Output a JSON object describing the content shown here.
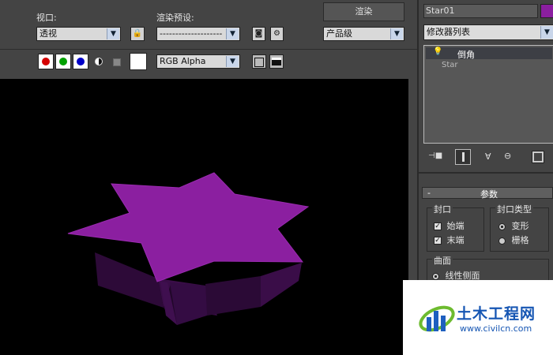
{
  "toolbar": {
    "viewport_label": "视口:",
    "viewport_value": "透视",
    "preset_label": "渲染预设:",
    "preset_value": "--------------------",
    "render_button": "渲染",
    "quality_value": "产品级",
    "channel_value": "RGB Alpha",
    "colors": {
      "red": "#d40000",
      "green": "#00a000",
      "blue": "#0000c8"
    }
  },
  "viewport": {
    "background": "#000000",
    "object_color": "#8b1fa0"
  },
  "panel": {
    "object_name": "Star01",
    "object_color": "#8b1fa0",
    "modifier_list_label": "修改器列表",
    "stack": [
      {
        "label": "倒角",
        "selected": true
      },
      {
        "label": "Star",
        "selected": false
      }
    ],
    "rollout_title": "参数",
    "rollout_toggle": "-",
    "cap_group": {
      "title": "封口",
      "items": [
        {
          "label": "始端",
          "checked": true
        },
        {
          "label": "末端",
          "checked": true
        }
      ]
    },
    "cap_type_group": {
      "title": "封口类型",
      "items": [
        {
          "label": "变形",
          "selected": true
        },
        {
          "label": "栅格",
          "selected": false
        }
      ]
    },
    "surface_group": {
      "title": "曲面",
      "items": [
        {
          "label": "线性侧面",
          "selected": true
        }
      ]
    }
  },
  "watermark": {
    "title": "土木工程网",
    "url": "www.civilcn.com"
  }
}
